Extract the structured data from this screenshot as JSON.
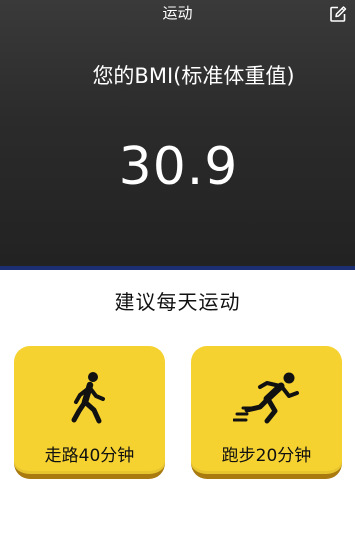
{
  "header": {
    "title": "运动",
    "edit_icon": "edit-icon"
  },
  "bmi": {
    "label": "您的BMI(标准体重值)",
    "value": "30.9"
  },
  "recommendation": {
    "title": "建议每天运动",
    "options": [
      {
        "label": "走路40分钟",
        "icon": "walking-person-icon"
      },
      {
        "label": "跑步20分钟",
        "icon": "running-person-icon"
      }
    ]
  },
  "colors": {
    "panel_dark": "#2b2b2b",
    "panel_border": "#1d2f73",
    "card_yellow": "#f6d231",
    "card_shadow": "#a97a0f"
  }
}
